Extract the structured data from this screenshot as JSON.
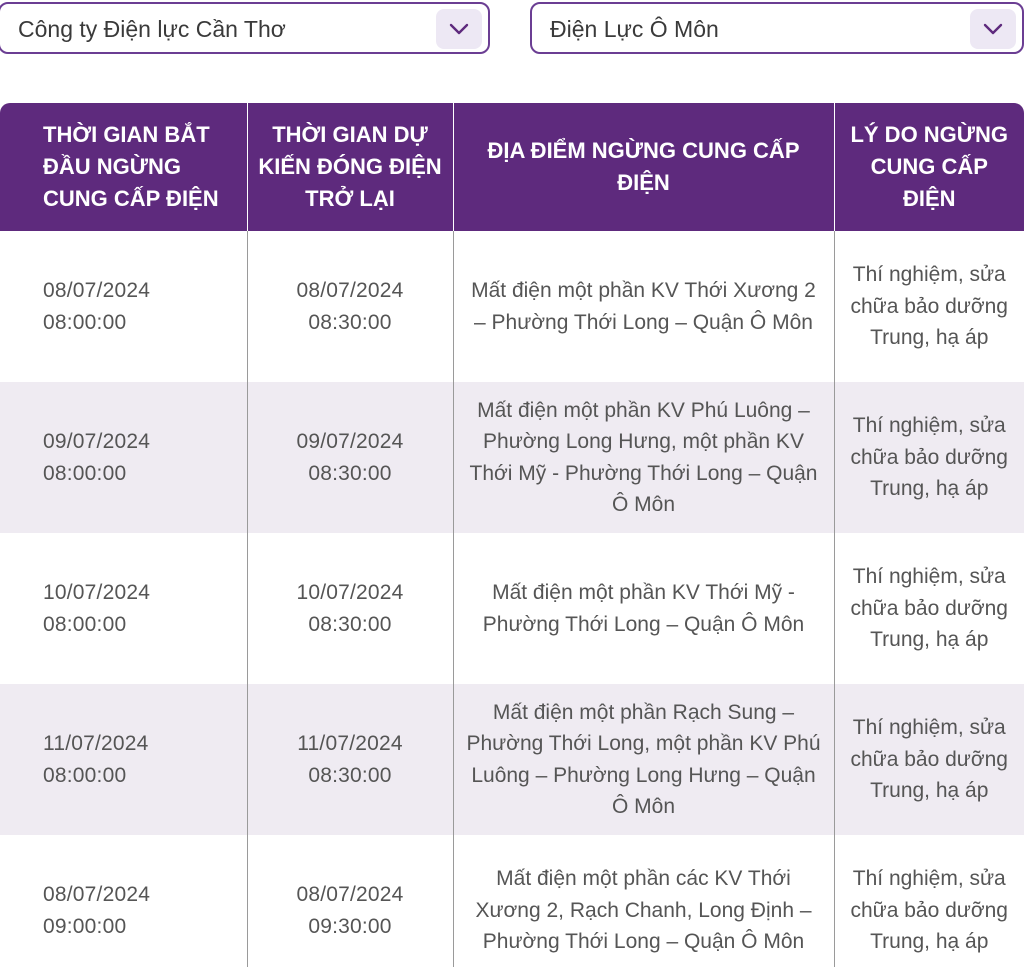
{
  "filters": {
    "company": "Công ty Điện lực Cần Thơ",
    "branch": "Điện Lực Ô Môn"
  },
  "table": {
    "headers": [
      "THỜI GIAN BẮT ĐẦU NGỪNG CUNG CẤP ĐIỆN",
      "THỜI GIAN DỰ KIẾN ĐÓNG ĐIỆN TRỞ LẠI",
      "ĐỊA ĐIỂM NGỪNG CUNG CẤP ĐIỆN",
      "LÝ DO NGỪNG CUNG CẤP ĐIỆN"
    ],
    "rows": [
      {
        "start_date": "08/07/2024",
        "start_time": "08:00:00",
        "end_date": "08/07/2024",
        "end_time": "08:30:00",
        "location": "Mất điện một phần KV Thới Xương 2 – Phường Thới Long – Quận Ô Môn",
        "reason": "Thí nghiệm, sửa chữa bảo dưỡng Trung, hạ áp"
      },
      {
        "start_date": "09/07/2024",
        "start_time": "08:00:00",
        "end_date": "09/07/2024",
        "end_time": "08:30:00",
        "location": "Mất điện một phần KV Phú Luông – Phường Long Hưng, một phần KV Thới Mỹ - Phường Thới Long – Quận Ô Môn",
        "reason": "Thí nghiệm, sửa chữa bảo dưỡng Trung, hạ áp"
      },
      {
        "start_date": "10/07/2024",
        "start_time": "08:00:00",
        "end_date": "10/07/2024",
        "end_time": "08:30:00",
        "location": "Mất điện một phần KV Thới Mỹ - Phường Thới Long – Quận Ô Môn",
        "reason": "Thí nghiệm, sửa chữa bảo dưỡng Trung, hạ áp"
      },
      {
        "start_date": "11/07/2024",
        "start_time": "08:00:00",
        "end_date": "11/07/2024",
        "end_time": "08:30:00",
        "location": "Mất điện một phần Rạch Sung – Phường Thới Long, một phần KV Phú Luông – Phường Long Hưng – Quận Ô Môn",
        "reason": "Thí nghiệm, sửa chữa bảo dưỡng Trung, hạ áp"
      },
      {
        "start_date": "08/07/2024",
        "start_time": "09:00:00",
        "end_date": "08/07/2024",
        "end_time": "09:30:00",
        "location": "Mất điện một phần các KV Thới Xương 2, Rạch Chanh, Long Định – Phường Thới Long – Quận Ô Môn",
        "reason": "Thí nghiệm, sửa chữa bảo dưỡng Trung, hạ áp"
      }
    ]
  }
}
